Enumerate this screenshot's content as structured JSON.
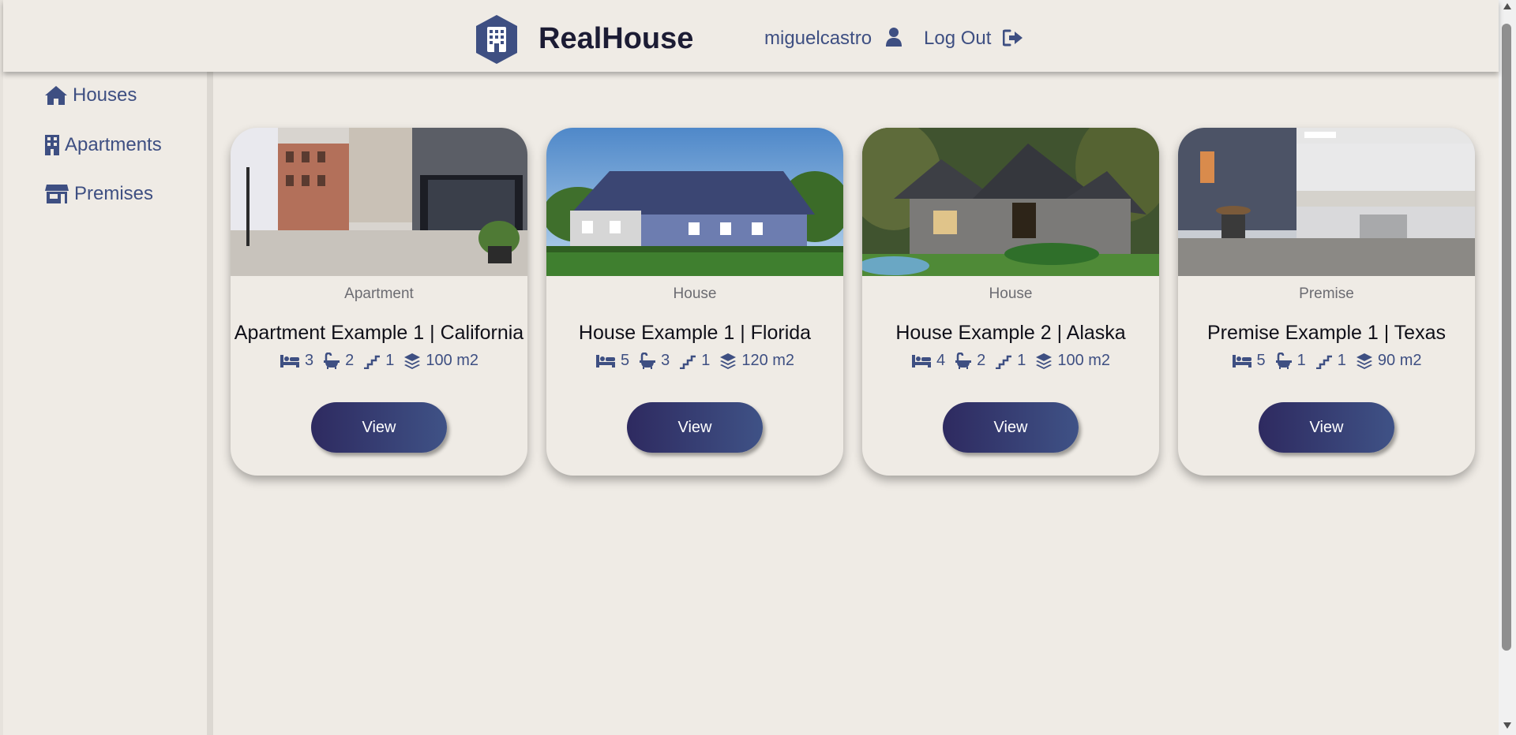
{
  "brand": {
    "name": "RealHouse"
  },
  "user": {
    "username": "miguelcastro",
    "logout_label": "Log Out"
  },
  "sidebar": {
    "items": [
      {
        "label": "Houses",
        "icon": "home-icon"
      },
      {
        "label": "Apartments",
        "icon": "building-icon"
      },
      {
        "label": "Premises",
        "icon": "store-icon"
      }
    ]
  },
  "cards": [
    {
      "type": "Apartment",
      "title": "Apartment Example 1 | California",
      "beds": "3",
      "baths": "2",
      "floors": "1",
      "area": "100 m2",
      "button": "View",
      "image": "apartment-street-photo"
    },
    {
      "type": "House",
      "title": "House Example 1 | Florida",
      "beds": "5",
      "baths": "3",
      "floors": "1",
      "area": "120 m2",
      "button": "View",
      "image": "blue-house-photo"
    },
    {
      "type": "House",
      "title": "House Example 2 | Alaska",
      "beds": "4",
      "baths": "2",
      "floors": "1",
      "area": "100 m2",
      "button": "View",
      "image": "stone-cottage-photo"
    },
    {
      "type": "Premise",
      "title": "Premise Example 1 | Texas",
      "beds": "5",
      "baths": "1",
      "floors": "1",
      "area": "90 m2",
      "button": "View",
      "image": "office-kitchen-photo"
    }
  ],
  "colors": {
    "background": "#efebe5",
    "accent": "#3e4f82",
    "button_gradient_start": "#2e2a60",
    "button_gradient_end": "#3f5286"
  }
}
